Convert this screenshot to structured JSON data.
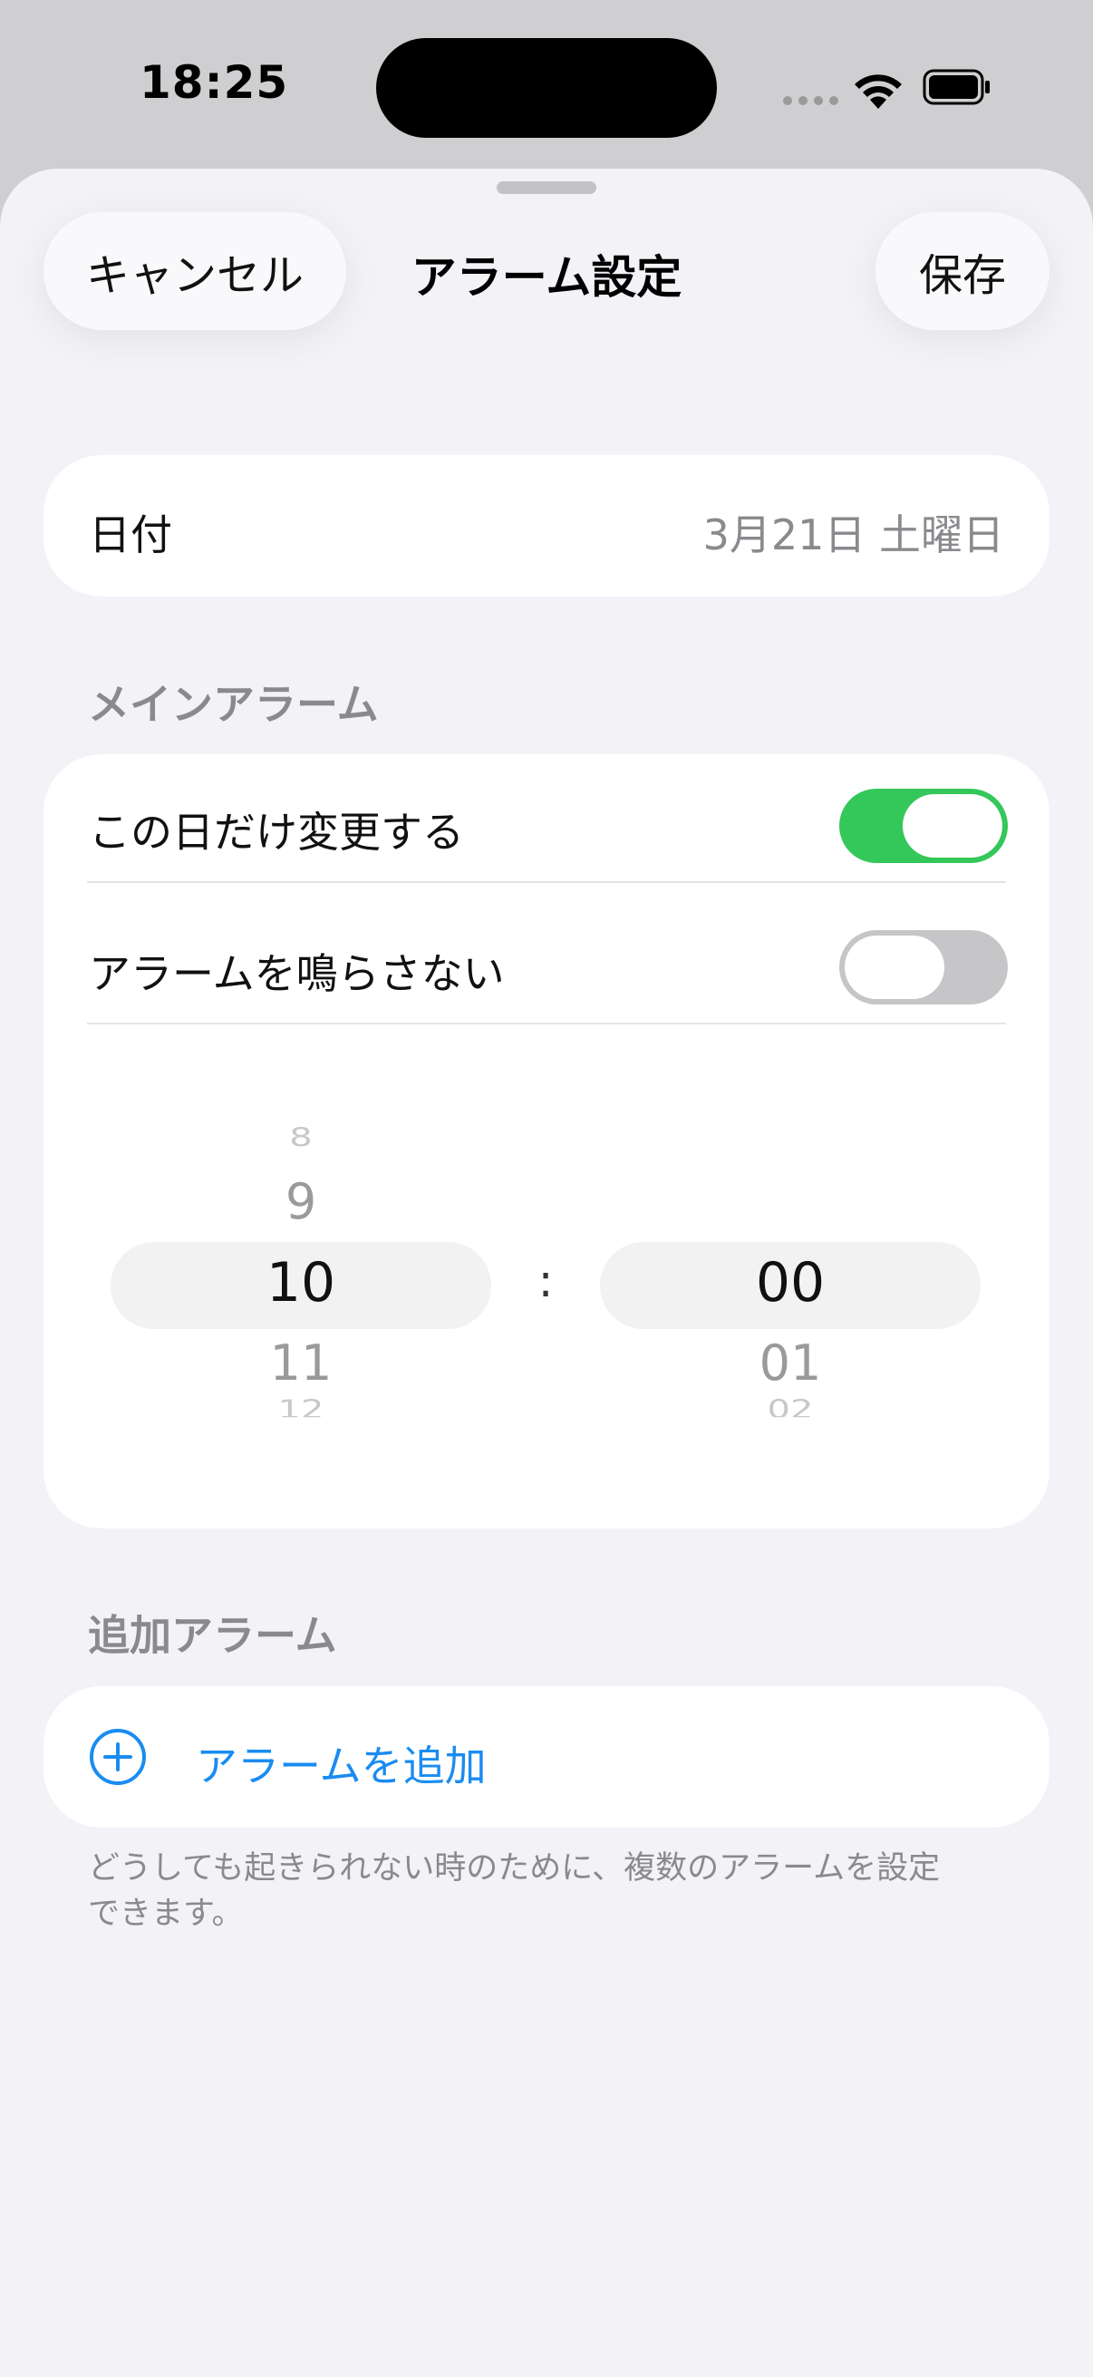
{
  "status_bar": {
    "time": "18:25"
  },
  "nav": {
    "cancel_label": "キャンセル",
    "title": "アラーム設定",
    "save_label": "保存"
  },
  "date_row": {
    "label": "日付",
    "value": "3月21日 土曜日"
  },
  "main_alarm": {
    "header": "メインアラーム",
    "change_today_label": "この日だけ変更する",
    "change_today_on": true,
    "silence_label": "アラームを鳴らさない",
    "silence_on": false
  },
  "time_picker": {
    "separator": ":",
    "hours": {
      "prev2": "8",
      "prev1": "9",
      "selected": "10",
      "next1": "11",
      "next2": "12"
    },
    "minutes": {
      "selected": "00",
      "next1": "01",
      "next2": "02"
    }
  },
  "extra_alarm": {
    "header": "追加アラーム",
    "add_label": "アラームを追加",
    "footer": "どうしても起きられない時のために、複数のアラームを設定できます。"
  },
  "colors": {
    "accent": "#1a8cf0",
    "toggle_on": "#34c759",
    "toggle_off": "#c6c6c8",
    "background": "#f2f2f7"
  }
}
